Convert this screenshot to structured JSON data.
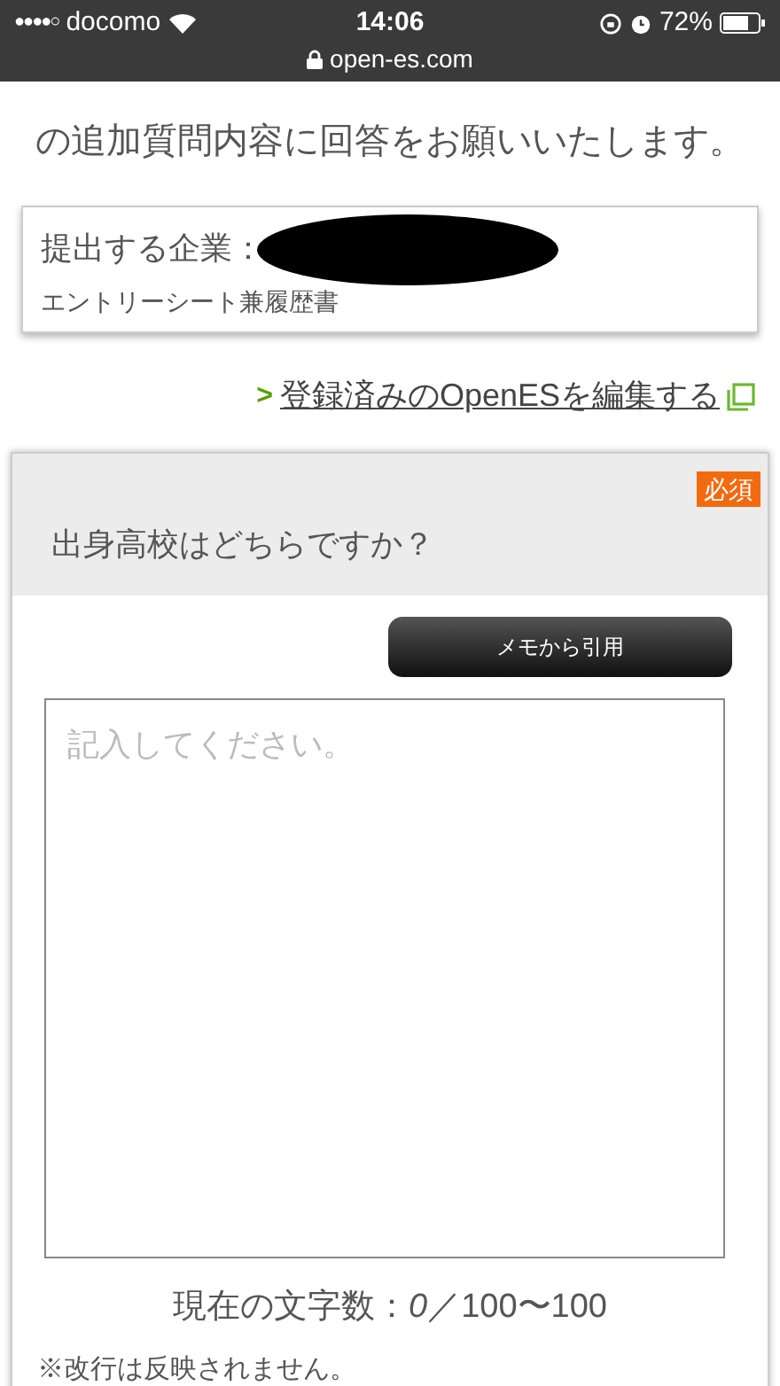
{
  "status_bar": {
    "signal": "●●●●○",
    "carrier": "docomo",
    "time": "14:06",
    "battery": "72%",
    "url": "open-es.com"
  },
  "intro": [
    "の追加質問内容に回答をお願いいたします。"
  ],
  "company_card": {
    "label": "提出する企業：",
    "document": "エントリーシート兼履歴書"
  },
  "edit_link": {
    "chevron": ">",
    "label": "登録済みのOpenESを編集する"
  },
  "question": {
    "required_badge": "必須",
    "title": "出身高校はどちらですか？",
    "memo_button": "メモから引用",
    "answer": {
      "placeholder": "記入してください。"
    },
    "counter": {
      "label": "現在の文字数：",
      "count": "0",
      "range": "／100〜100"
    },
    "notes": [
      "※改行は反映されません。"
    ]
  }
}
